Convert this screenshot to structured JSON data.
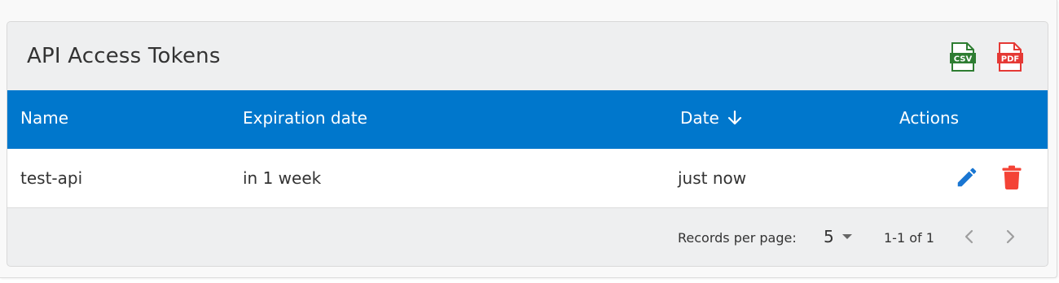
{
  "card": {
    "title": "API Access Tokens",
    "exports": [
      {
        "name": "csv",
        "label": "CSV",
        "color": "#2e7d32"
      },
      {
        "name": "pdf",
        "label": "PDF",
        "color": "#e53935"
      }
    ]
  },
  "table": {
    "header_bg": "#0077cc",
    "columns": {
      "name": "Name",
      "expiration": "Expiration date",
      "date": "Date",
      "actions": "Actions"
    },
    "sort": {
      "column": "date",
      "direction": "descending",
      "icon": "arrow-down-icon"
    },
    "rows": [
      {
        "name": "test-api",
        "expiration": "in 1 week",
        "date": "just now"
      }
    ],
    "row_actions": [
      {
        "name": "edit",
        "icon": "pencil-icon",
        "color": "#1976d2"
      },
      {
        "name": "delete",
        "icon": "trash-icon",
        "color": "#f44336"
      }
    ]
  },
  "pagination": {
    "records_per_page_label": "Records per page:",
    "records_per_page_value": "5",
    "range_text": "1-1 of 1"
  }
}
